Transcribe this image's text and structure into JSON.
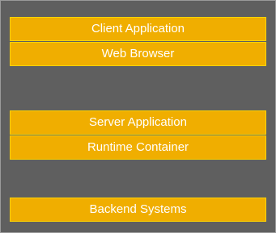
{
  "layers": {
    "client": {
      "application": "Client Application",
      "container": "Web Browser"
    },
    "server": {
      "application": "Server Application",
      "container": "Runtime Container"
    },
    "backend": {
      "systems": "Backend Systems"
    }
  },
  "colors": {
    "background": "#5f5f5f",
    "box_fill": "#f0ae00",
    "box_border": "#ffd400",
    "text": "#ffffff"
  }
}
